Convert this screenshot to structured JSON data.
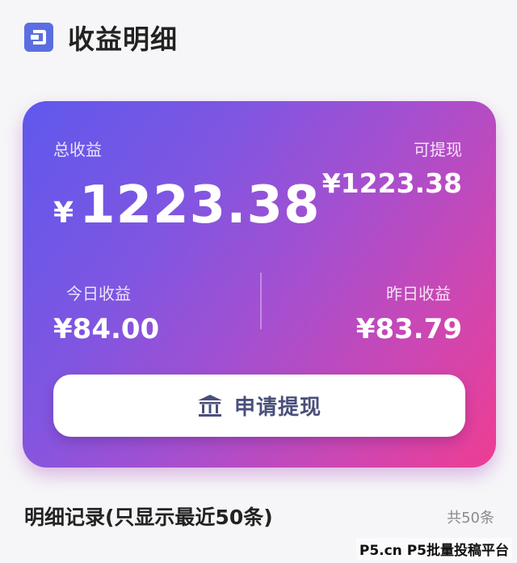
{
  "header": {
    "title": "收益明细",
    "icon": "wallet-icon"
  },
  "card": {
    "gradient_start": "#5f58ec",
    "gradient_end": "#ee3d92",
    "total_label": "总收益",
    "total_currency": "¥",
    "total_amount": "1223.38",
    "withdrawable_label": "可提现",
    "withdrawable_value": "¥1223.38",
    "today_label": "今日收益",
    "today_value": "¥84.00",
    "yesterday_label": "昨日收益",
    "yesterday_value": "¥83.79",
    "withdraw_button": {
      "label": "申请提现",
      "icon": "bank-icon",
      "text_color": "#4a4f7a"
    }
  },
  "records": {
    "title": "明细记录(只显示最近50条)",
    "count": "共50条"
  },
  "watermark": "P5.cn P5批量投稿平台"
}
